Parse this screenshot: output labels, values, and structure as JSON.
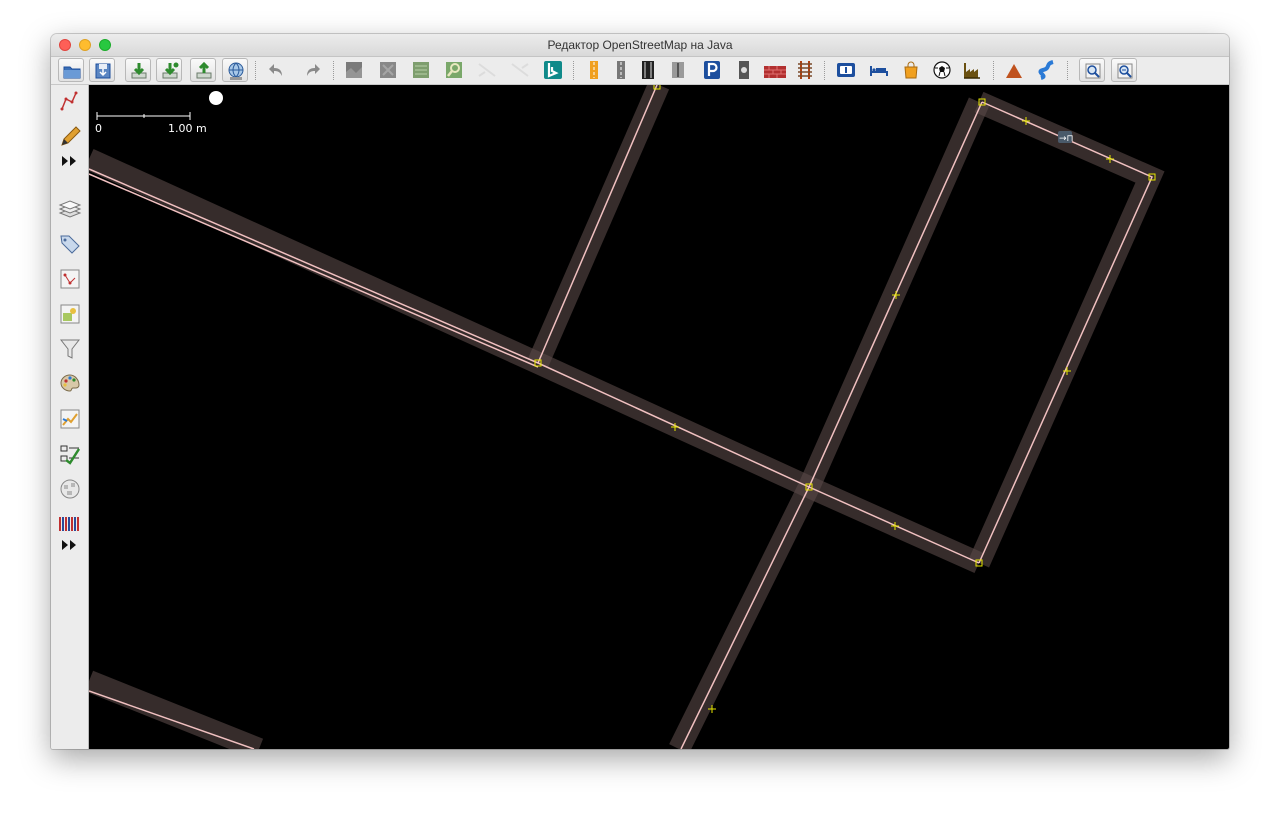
{
  "window": {
    "title": "Редактор OpenStreetMap на Java"
  },
  "toolbar": {
    "buttons": [
      {
        "name": "open-file-button",
        "icon": "folder-icon"
      },
      {
        "name": "save-button",
        "icon": "save-icon"
      },
      {
        "name": "download-button",
        "icon": "download-icon"
      },
      {
        "name": "update-data-button",
        "icon": "update-data-icon"
      },
      {
        "name": "upload-button",
        "icon": "upload-icon"
      },
      {
        "name": "download-along-button",
        "icon": "globe-icon"
      },
      {
        "name": "undo-button",
        "icon": "undo-icon"
      },
      {
        "name": "redo-button",
        "icon": "redo-icon"
      },
      {
        "name": "preset-highway-button",
        "icon": "road-icon"
      },
      {
        "name": "preset-residential-button",
        "icon": "residential-road-icon"
      },
      {
        "name": "preset-parking-button",
        "icon": "parking-icon"
      },
      {
        "name": "preset-barrier-button",
        "icon": "wall-icon"
      },
      {
        "name": "preset-railway-button",
        "icon": "railway-icon"
      },
      {
        "name": "preset-information-button",
        "icon": "information-icon"
      },
      {
        "name": "preset-accommodation-button",
        "icon": "bed-icon"
      },
      {
        "name": "preset-shop-button",
        "icon": "shopping-bag-icon"
      },
      {
        "name": "preset-sport-button",
        "icon": "football-icon"
      },
      {
        "name": "preset-industrial-button",
        "icon": "factory-icon"
      },
      {
        "name": "preset-peak-button",
        "icon": "mountain-icon"
      },
      {
        "name": "preset-waterway-button",
        "icon": "river-icon"
      },
      {
        "name": "zoom-to-selection-button",
        "icon": "zoom-icon"
      },
      {
        "name": "zoom-to-data-button",
        "icon": "zoom-data-icon"
      }
    ],
    "colors": {
      "accent_blue": "#1d4f9e",
      "arrow_green": "#2e8b2e",
      "bing_teal": "#108a8a",
      "peak_orange": "#c0521e"
    }
  },
  "sidebar": {
    "tools": [
      {
        "name": "select-tool",
        "icon": "select-icon"
      },
      {
        "name": "draw-tool",
        "icon": "pencil-icon"
      },
      {
        "name": "more-tools",
        "icon": "double-arrow-icon"
      },
      {
        "name": "layers-toggle",
        "icon": "layers-icon"
      },
      {
        "name": "properties-toggle",
        "icon": "tag-icon"
      },
      {
        "name": "selection-list-toggle",
        "icon": "selection-list-icon"
      },
      {
        "name": "relations-toggle",
        "icon": "relations-icon"
      },
      {
        "name": "filter-toggle",
        "icon": "filter-icon"
      },
      {
        "name": "map-paint-styles-toggle",
        "icon": "palette-icon"
      },
      {
        "name": "history-toggle",
        "icon": "history-icon"
      },
      {
        "name": "validation-toggle",
        "icon": "validation-icon"
      },
      {
        "name": "notes-toggle",
        "icon": "wiki-globe-icon"
      },
      {
        "name": "changeset-toggle",
        "icon": "barcode-icon"
      },
      {
        "name": "more-toggles",
        "icon": "double-arrow-icon"
      }
    ]
  },
  "map": {
    "background": "#000000",
    "way_color": "#f0c0c0",
    "area_fill_color": "#5a4a48",
    "node_color": "#e8e800",
    "scale": {
      "zero_label": "0",
      "length_label": "1.00 m"
    },
    "entrance_label": "→⊓"
  }
}
